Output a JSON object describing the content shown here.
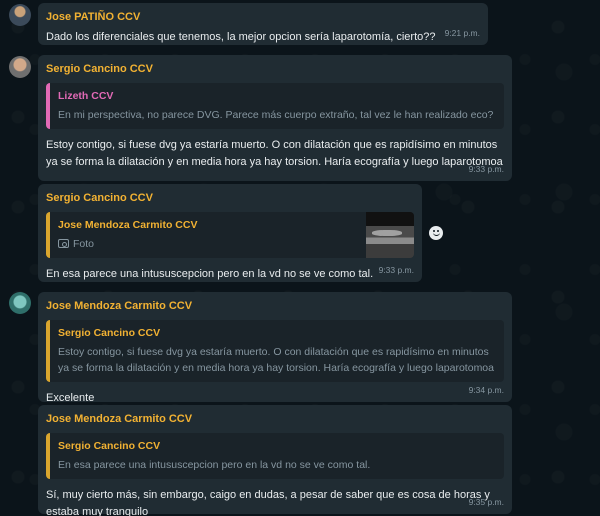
{
  "colors": {
    "background": "#0b141a",
    "bubble": "#202c33",
    "quote_bg": "#1a2329",
    "name_yellow": "#f2b233",
    "name_pink": "#e26ab6",
    "quote_bar_yellow": "#d9a62e",
    "quote_bar_pink": "#e26ab6"
  },
  "messages": [
    {
      "sender": "Jose PATIÑO CCV",
      "text": "Dado los diferenciales que tenemos, la mejor opcion sería laparotomía, cierto??",
      "time": "9:21 p.m."
    },
    {
      "sender": "Sergio Cancino CCV",
      "quote": {
        "name": "Lizeth CCV",
        "text": "En mi perspectiva, no parece DVG. Parece más cuerpo extraño, tal vez le han realizado eco?"
      },
      "text": "Estoy contigo, si fuese dvg ya estaría muerto.  O con dilatación que es rapidísimo en minutos ya se forma la dilatación y en media hora ya hay torsion. Haría ecografía y luego laparotomoa",
      "time": "9:33 p.m."
    },
    {
      "sender": "Sergio Cancino CCV",
      "quote": {
        "name": "Jose Mendoza Carmito CCV",
        "text": "Foto",
        "icon": "camera-icon"
      },
      "text": "En esa parece una intususcepcion pero en la vd no se ve como tal.",
      "time": "9:33 p.m."
    },
    {
      "sender": "Jose Mendoza Carmito CCV",
      "quote": {
        "name": "Sergio Cancino CCV",
        "text": "Estoy contigo, si fuese dvg ya estaría muerto.  O con dilatación que es rapidísimo en minutos ya se forma la dilatación y en media hora ya hay torsion. Haría ecografía y luego laparotomoa"
      },
      "text": "Excelente",
      "time": "9:34 p.m."
    },
    {
      "sender": "Jose Mendoza Carmito CCV",
      "quote": {
        "name": "Sergio Cancino CCV",
        "text": "En esa parece una intususcepcion pero en la vd no se ve como tal."
      },
      "text": "Sí, muy cierto más, sin embargo, caigo en dudas, a pesar de saber que es cosa de horas y estaba muy tranquilo",
      "time": "9:35 p.m."
    }
  ]
}
